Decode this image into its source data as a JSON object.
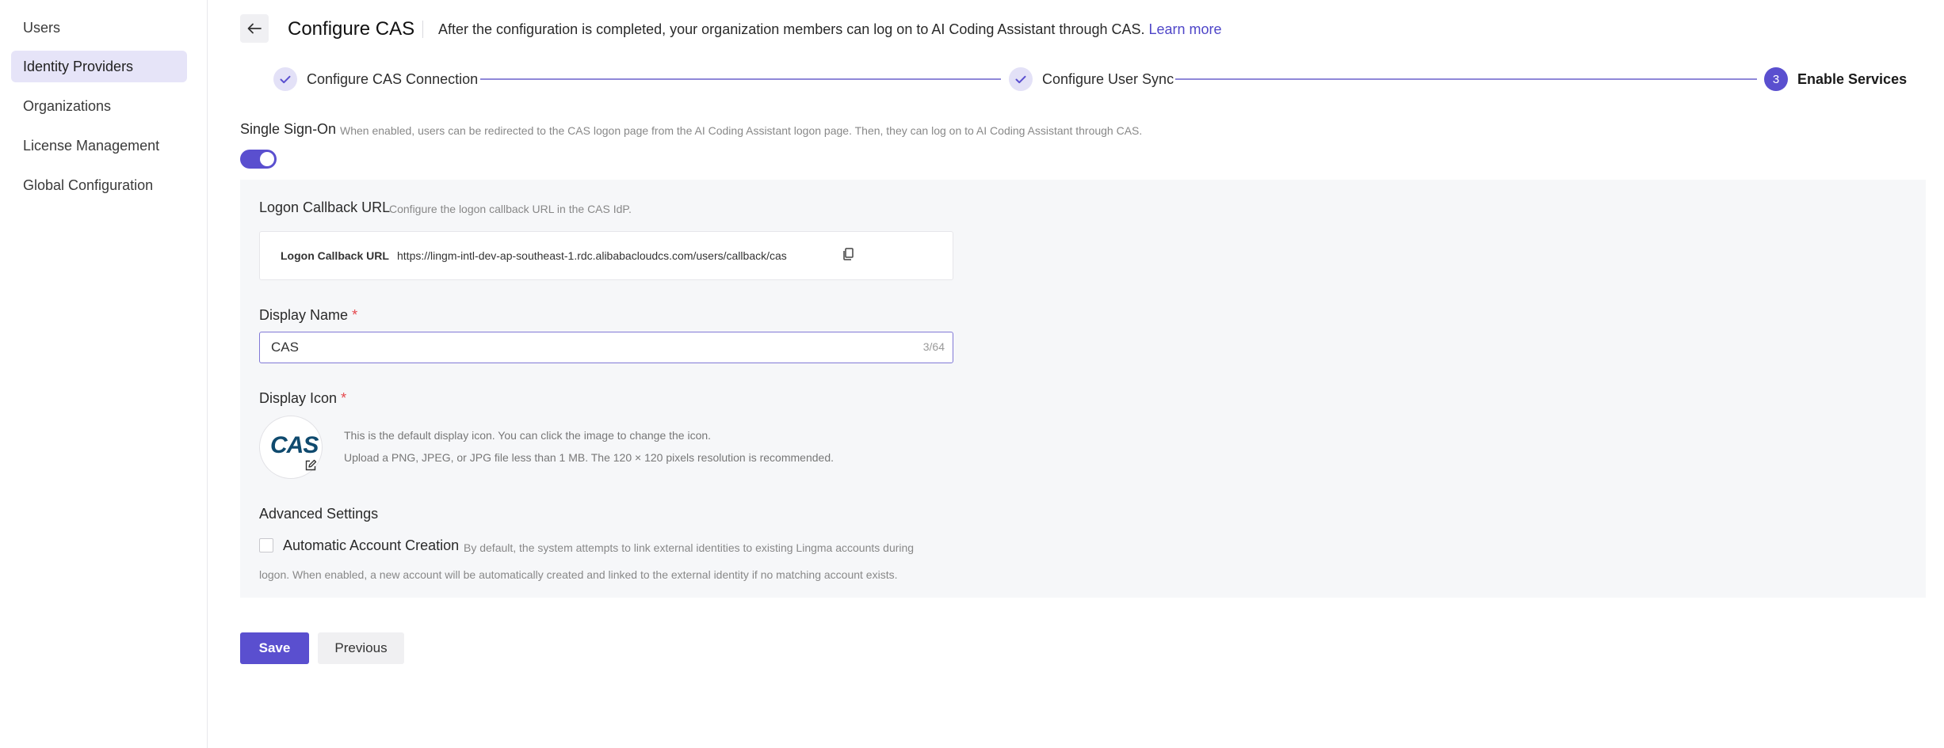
{
  "sidebar": {
    "items": [
      {
        "label": "Users",
        "active": false
      },
      {
        "label": "Identity Providers",
        "active": true
      },
      {
        "label": "Organizations",
        "active": false
      },
      {
        "label": "License Management",
        "active": false
      },
      {
        "label": "Global Configuration",
        "active": false
      }
    ]
  },
  "header": {
    "back_icon": "arrow-left-icon",
    "title": "Configure CAS",
    "description": "After the configuration is completed, your organization members can log on to AI Coding Assistant through CAS.",
    "learn_more": "Learn more"
  },
  "steps": [
    {
      "label": "Configure CAS Connection",
      "status": "done",
      "icon": "check-icon"
    },
    {
      "label": "Configure User Sync",
      "status": "done",
      "icon": "check-icon"
    },
    {
      "number": "3",
      "label": "Enable Services",
      "status": "current"
    }
  ],
  "sso": {
    "label": "Single Sign-On",
    "description": "When enabled, users can be redirected to the CAS logon page from the AI Coding Assistant logon page. Then, they can log on to AI Coding Assistant through CAS.",
    "enabled": true
  },
  "callback": {
    "label": "Logon Callback URL",
    "hint": "Configure the logon callback URL in the CAS IdP.",
    "box_key": "Logon Callback URL",
    "url": "https://lingm-intl-dev-ap-southeast-1.rdc.alibabacloudcs.com/users/callback/cas",
    "copy_icon": "copy-icon"
  },
  "display_name": {
    "label": "Display Name",
    "required_mark": "*",
    "value": "CAS",
    "counter": "3/64"
  },
  "display_icon": {
    "label": "Display Icon",
    "required_mark": "*",
    "logo_text": "CAS",
    "edit_icon": "edit-icon",
    "hint_line1": "This is the default display icon. You can click the image to change the icon.",
    "hint_line2": "Upload a PNG, JPEG, or JPG file less than 1 MB. The 120 × 120 pixels resolution is recommended."
  },
  "advanced": {
    "label": "Advanced Settings",
    "auto_account": {
      "label": "Automatic Account Creation",
      "checked": false,
      "desc_line1": "By default, the system attempts to link external identities to existing Lingma accounts during",
      "desc_line2": "logon. When enabled, a new account will be automatically created and linked to the external identity if no matching account exists."
    }
  },
  "actions": {
    "save": "Save",
    "previous": "Previous"
  },
  "colors": {
    "accent": "#5a4fcf",
    "sidebar_active_bg": "#e6e4f8",
    "panel_bg": "#f6f7f9",
    "required": "#e5484d"
  }
}
